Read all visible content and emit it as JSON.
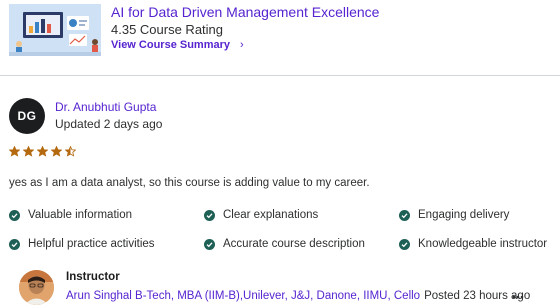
{
  "course": {
    "title": "AI for Data Driven Management Excellence",
    "rating_text": "4.35 Course Rating",
    "summary_link": "View Course Summary",
    "summary_chevron": "›",
    "thumbnail_icon": "course-thumbnail-illustration"
  },
  "review": {
    "avatar_initials": "DG",
    "reviewer_name": "Dr. Anubhuti Gupta",
    "updated": "Updated 2 days ago",
    "rating": 4.5,
    "star_color": "#b4690e",
    "text": "yes as I am a data analyst, so this course is adding value to my career."
  },
  "tags": [
    "Valuable information",
    "Clear explanations",
    "Engaging delivery",
    "Helpful practice activities",
    "Accurate course description",
    "Knowledgeable instructor"
  ],
  "tag_check_color": "#1e6055",
  "instructor": {
    "heading": "Instructor",
    "name": "Arun Singhal B-Tech, MBA (IIM-B),Unilever, J&J, Danone, IIMU, Cello",
    "posted": "Posted 23 hours ago",
    "more_icon": "more-options-icon"
  },
  "colors": {
    "link": "#5624d0",
    "text": "#2d2f31",
    "divider": "#d1d7dc"
  }
}
